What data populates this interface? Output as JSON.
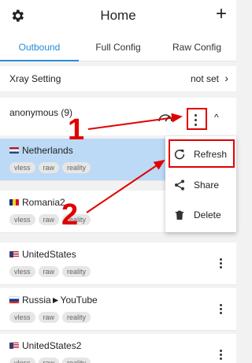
{
  "appbar": {
    "title": "Home",
    "plus": "+"
  },
  "tabs": [
    "Outbound",
    "Full Config",
    "Raw Config"
  ],
  "xray_setting": {
    "label": "Xray Setting",
    "value": "not set",
    "chevron": "›"
  },
  "group": {
    "name": "anonymous (9)",
    "collapse": "^"
  },
  "servers": [
    {
      "name": "Netherlands",
      "tags": [
        "vless",
        "raw",
        "reality"
      ],
      "flag_colors": [
        "#AE1C28",
        "#FFFFFF",
        "#21468B"
      ]
    },
    {
      "name": "Romania2",
      "tags": [
        "vless",
        "raw",
        "reality"
      ],
      "flag_colors": [
        "#002B7F",
        "#FCD116",
        "#CE1126"
      ]
    },
    {
      "name": "UnitedStates",
      "tags": [
        "vless",
        "raw",
        "reality"
      ],
      "flag_colors": [
        "#3C3B6E",
        "#B22234",
        "#FFFFFF"
      ]
    },
    {
      "name": "Russia►YouTube",
      "tags": [
        "vless",
        "raw",
        "reality"
      ],
      "flag_colors": [
        "#FFFFFF",
        "#0039A6",
        "#D52B1E"
      ]
    },
    {
      "name": "UnitedStates2",
      "tags": [
        "vless",
        "raw",
        "reality"
      ],
      "flag_colors": [
        "#3C3B6E",
        "#B22234",
        "#FFFFFF"
      ]
    }
  ],
  "context_menu": {
    "items": [
      {
        "label": "Refresh",
        "icon": "refresh-icon"
      },
      {
        "label": "Share",
        "icon": "share-icon"
      },
      {
        "label": "Delete",
        "icon": "trash-icon"
      }
    ]
  },
  "annotations": {
    "one": "1",
    "two": "2"
  },
  "colors": {
    "accent": "#2a8bd6",
    "selected_row": "#bcd9f5",
    "annotation": "#e10000"
  }
}
